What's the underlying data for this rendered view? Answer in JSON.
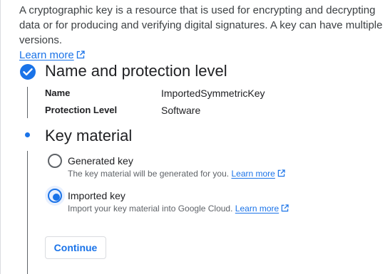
{
  "intro": {
    "text": "A cryptographic key is a resource that is used for encrypting and decrypting data or for producing and verifying digital signatures. A key can have multiple versions.",
    "learn_more": "Learn more",
    "learn_more_icon": "open-in-new-icon"
  },
  "step1": {
    "status_icon": "check-circle-icon",
    "title": "Name and protection level",
    "fields": [
      {
        "label": "Name",
        "value": "ImportedSymmetricKey"
      },
      {
        "label": "Protection Level",
        "value": "Software"
      }
    ]
  },
  "step2": {
    "title": "Key material",
    "options": [
      {
        "label": "Generated key",
        "description": "The key material will be generated for you.",
        "link": "Learn more",
        "selected": false
      },
      {
        "label": "Imported key",
        "description": "Import your key material into Google Cloud.",
        "link": "Learn more",
        "selected": true
      }
    ],
    "continue_label": "Continue"
  },
  "colors": {
    "accent": "#1a73e8",
    "text": "#202124",
    "secondary_text": "#5f6368",
    "border": "#dadce0"
  }
}
